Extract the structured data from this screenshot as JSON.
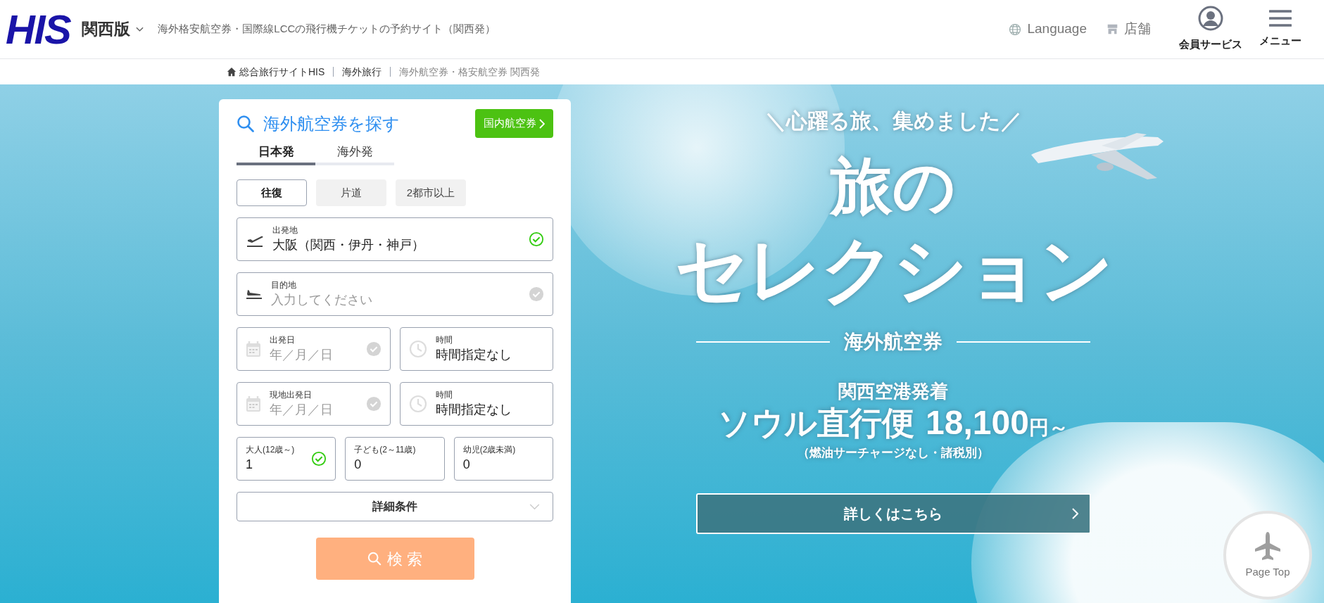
{
  "header": {
    "logo": "HIS",
    "region": "関西版",
    "tagline": "海外格安航空券・国際線LCCの飛行機チケットの予約サイト（関西発）",
    "links": [
      {
        "kind": "language",
        "label": "Language"
      },
      {
        "kind": "store",
        "label": "店舗"
      }
    ],
    "buttons": [
      {
        "kind": "member",
        "label": "会員サービス"
      },
      {
        "kind": "menu",
        "label": "メニュー"
      }
    ]
  },
  "breadcrumb": [
    "総合旅行サイトHIS",
    "海外旅行",
    "海外航空券・格安航空券 関西発"
  ],
  "search_form": {
    "title": "海外航空券を探す",
    "domestic_button": "国内航空券",
    "tabs": [
      {
        "label": "日本発",
        "selected": true
      },
      {
        "label": "海外発",
        "selected": false
      }
    ],
    "trip_types": [
      {
        "label": "往復",
        "selected": true
      },
      {
        "label": "片道",
        "selected": false
      },
      {
        "label": "2都市以上",
        "selected": false
      }
    ],
    "origin": {
      "label": "出発地",
      "value": "大阪（関西・伊丹・神戸）",
      "checked": true
    },
    "destination": {
      "label": "目的地",
      "placeholder": "入力してください",
      "checked": false
    },
    "date_rows": [
      {
        "date_label": "出発日",
        "date_placeholder": "年／月／日",
        "checked": false,
        "time_label": "時間",
        "time_value": "時間指定なし"
      },
      {
        "date_label": "現地出発日",
        "date_placeholder": "年／月／日",
        "checked": false,
        "time_label": "時間",
        "time_value": "時間指定なし"
      }
    ],
    "passengers": [
      {
        "label": "大人(12歳～)",
        "value": "1",
        "checked": true
      },
      {
        "label": "子ども(2～11歳)",
        "value": "0",
        "checked": false
      },
      {
        "label": "幼児(2歳未満)",
        "value": "0",
        "checked": false
      }
    ],
    "details": "詳細条件",
    "search_button": "検 索"
  },
  "banner": {
    "tagline": "＼心躍る旅、集めました／",
    "title_line_1": "旅の",
    "title_line_2": "セレクション",
    "category": "海外航空券",
    "route": "関西空港発着",
    "offer": "ソウル直行便",
    "price": "18,100",
    "price_unit": "円～",
    "note": "（燃油サーチャージなし・諸税別）",
    "button": "詳しくはこちら"
  },
  "page_top": "Page Top"
}
